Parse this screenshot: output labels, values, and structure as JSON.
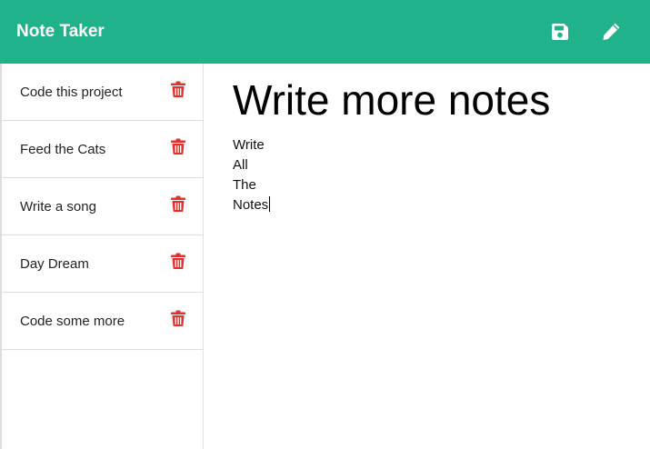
{
  "navbar": {
    "brand": "Note Taker",
    "color": "#20b28a",
    "save_icon": "save-icon",
    "new_icon": "pencil-icon"
  },
  "sidebar": {
    "notes": [
      {
        "title": "Code this project",
        "delete_icon": "trash-icon"
      },
      {
        "title": "Feed the Cats",
        "delete_icon": "trash-icon"
      },
      {
        "title": "Write a song",
        "delete_icon": "trash-icon"
      },
      {
        "title": "Day Dream",
        "delete_icon": "trash-icon"
      },
      {
        "title": "Code some more",
        "delete_icon": "trash-icon"
      }
    ],
    "delete_color": "#e0322f"
  },
  "editor": {
    "title": "Write more notes",
    "text": "Write\nAll\nThe\nNotes"
  }
}
